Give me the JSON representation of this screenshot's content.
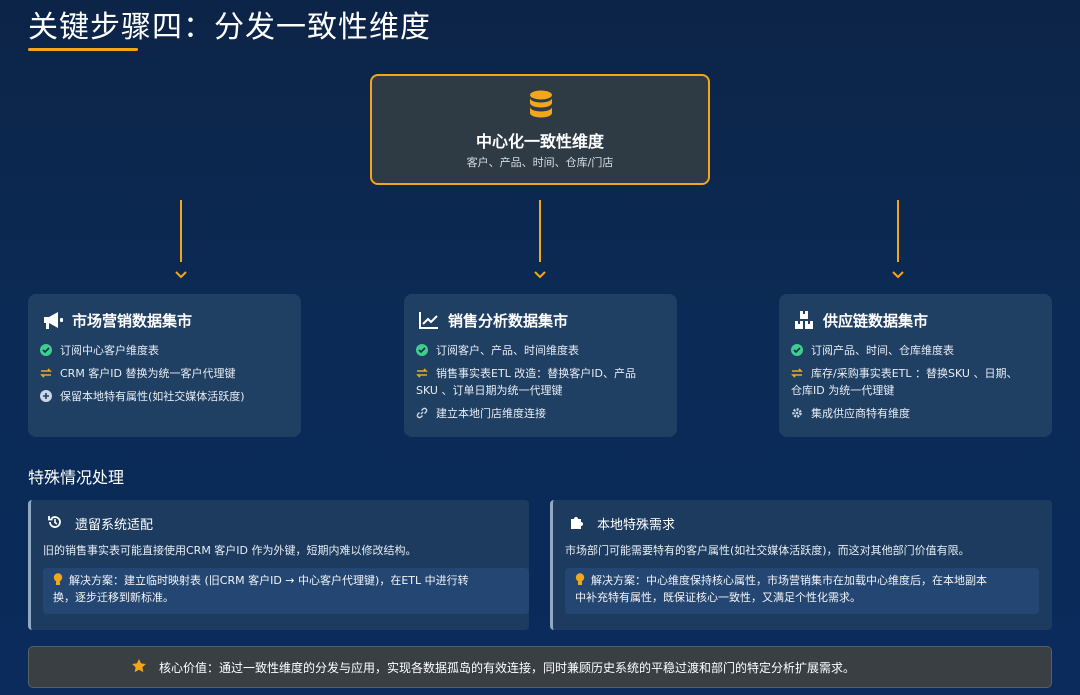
{
  "header": {
    "title": "关键步骤四：分发一致性维度"
  },
  "center": {
    "icon": "database-icon",
    "title": "中心化一致性维度",
    "subtitle": "客户、产品、时间、仓库/门店"
  },
  "marts": [
    {
      "icon": "megaphone-icon",
      "title": "市场营销数据集市",
      "items": [
        {
          "icon": "check-circle-icon",
          "text": "订阅中心客户维度表"
        },
        {
          "icon": "exchange-icon",
          "text": "CRM 客户ID 替换为统一客户代理键"
        },
        {
          "icon": "plus-circle-icon",
          "text": "保留本地特有属性(如社交媒体活跃度)"
        }
      ]
    },
    {
      "icon": "line-chart-icon",
      "title": "销售分析数据集市",
      "items": [
        {
          "icon": "check-circle-icon",
          "text": "订阅客户、产品、时间维度表"
        },
        {
          "icon": "exchange-icon",
          "text_line1": "销售事实表ETL 改造：替换客户ID、产品",
          "text_line2": "SKU 、订单日期为统一代理键"
        },
        {
          "icon": "link-icon",
          "text": "建立本地门店维度连接"
        }
      ]
    },
    {
      "icon": "boxes-icon",
      "title": "供应链数据集市",
      "items": [
        {
          "icon": "check-circle-icon",
          "text": "订阅产品、时间、仓库维度表"
        },
        {
          "icon": "exchange-icon",
          "text_line1": "库存/采购事实表ETL ：替换SKU 、日期、",
          "text_line2": "仓库ID 为统一代理键"
        },
        {
          "icon": "gear-icon",
          "text": "集成供应商特有维度"
        }
      ]
    }
  ],
  "special": {
    "title": "特殊情况处理",
    "cases": [
      {
        "icon": "history-icon",
        "title": "遗留系统适配",
        "desc": "旧的销售事实表可能直接使用CRM 客户ID 作为外键，短期内难以修改结构。",
        "solution_line1": "解决方案：建立临时映射表 (旧CRM 客户ID → 中心客户代理键)，在ETL 中进行转",
        "solution_line2": "换，逐步迁移到新标准。"
      },
      {
        "icon": "puzzle-icon",
        "title": "本地特殊需求",
        "desc": "市场部门可能需要特有的客户属性(如社交媒体活跃度)，而这对其他部门价值有限。",
        "solution_line1": "解决方案：中心维度保持核心属性，市场营销集市在加载中心维度后，在本地副本",
        "solution_line2": "中补充特有属性，既保证核心一致性，又满足个性化需求。"
      }
    ]
  },
  "footer": {
    "icon": "star-icon",
    "text": "核心价值：通过一致性维度的分发与应用，实现各数据孤岛的有效连接，同时兼顾历史系统的平稳过渡和部门的特定分析扩展需求。"
  },
  "colors": {
    "accent": "#f2a71b",
    "background": "#0b2a55",
    "card": "#1f3f63",
    "check": "#3ecf8e"
  }
}
